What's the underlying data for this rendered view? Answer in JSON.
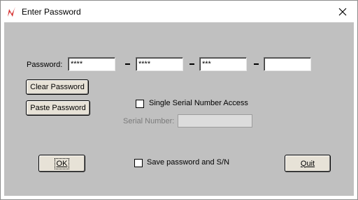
{
  "window": {
    "title": "Enter Password"
  },
  "password": {
    "label": "Password:",
    "segments": [
      "****",
      "****",
      "***",
      ""
    ]
  },
  "buttons": {
    "clear_password": "Clear Password",
    "paste_password": "Paste Password",
    "ok": "OK",
    "quit": "Quit"
  },
  "serial": {
    "single_access_label": "Single Serial Number Access",
    "single_access_checked": false,
    "serial_number_label": "Serial Number:",
    "serial_number_value": ""
  },
  "save": {
    "label": "Save password and S/N",
    "checked": false
  },
  "icons": {
    "app": "app-logo-icon",
    "close": "close-icon"
  },
  "colors": {
    "client_bg": "#c0c0c0",
    "button_bg": "#e7e2d7",
    "logo_red": "#d42a2a"
  }
}
